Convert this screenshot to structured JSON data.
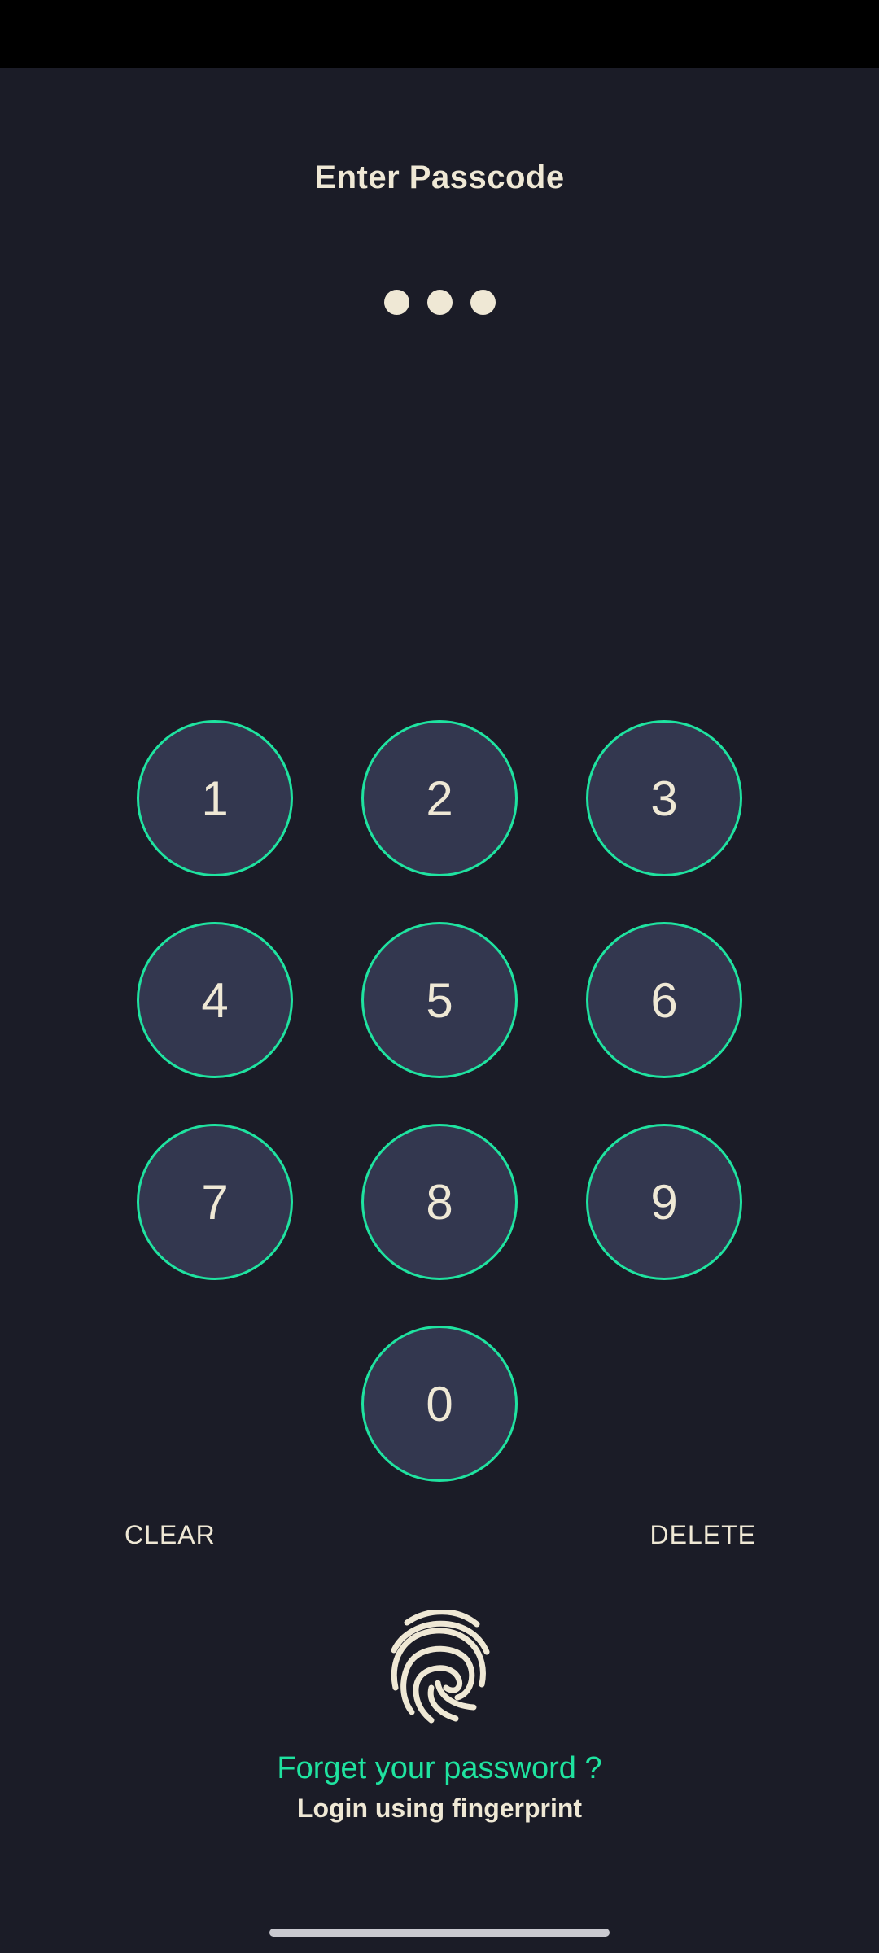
{
  "header": {
    "title": "Enter Passcode",
    "entered_digits": 3
  },
  "keypad": {
    "keys": [
      "1",
      "2",
      "3",
      "4",
      "5",
      "6",
      "7",
      "8",
      "9",
      "0"
    ]
  },
  "actions": {
    "clear_label": "CLEAR",
    "delete_label": "DELETE"
  },
  "fingerprint": {
    "icon": "fingerprint-icon",
    "forgot_label": "Forget your password ?",
    "login_label": "Login using fingerprint"
  },
  "colors": {
    "background": "#1b1c27",
    "accent": "#1fe3a0",
    "key_fill": "#33374f",
    "text": "#efe8d5"
  }
}
